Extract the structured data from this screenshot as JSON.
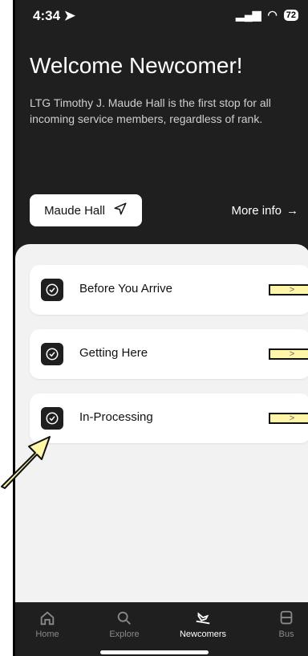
{
  "status": {
    "time": "4:34",
    "battery": "72"
  },
  "header": {
    "title": "Welcome Newcomer!",
    "subtitle": "LTG Timothy J. Maude Hall is the first stop for all incoming service members, regardless of rank."
  },
  "actions": {
    "maude_button": "Maude Hall",
    "more_info": "More info"
  },
  "cards": [
    {
      "label": "Before You Arrive",
      "chev": ">"
    },
    {
      "label": "Getting Here",
      "chev": ">"
    },
    {
      "label": "In-Processing",
      "chev": ">"
    }
  ],
  "tabs": [
    {
      "label": "Home"
    },
    {
      "label": "Explore"
    },
    {
      "label": "Newcomers"
    },
    {
      "label": "Bus"
    }
  ],
  "colors": {
    "background": "#1f1f1f",
    "sheet": "#f2f2f2",
    "highlight": "#fff6a8"
  }
}
